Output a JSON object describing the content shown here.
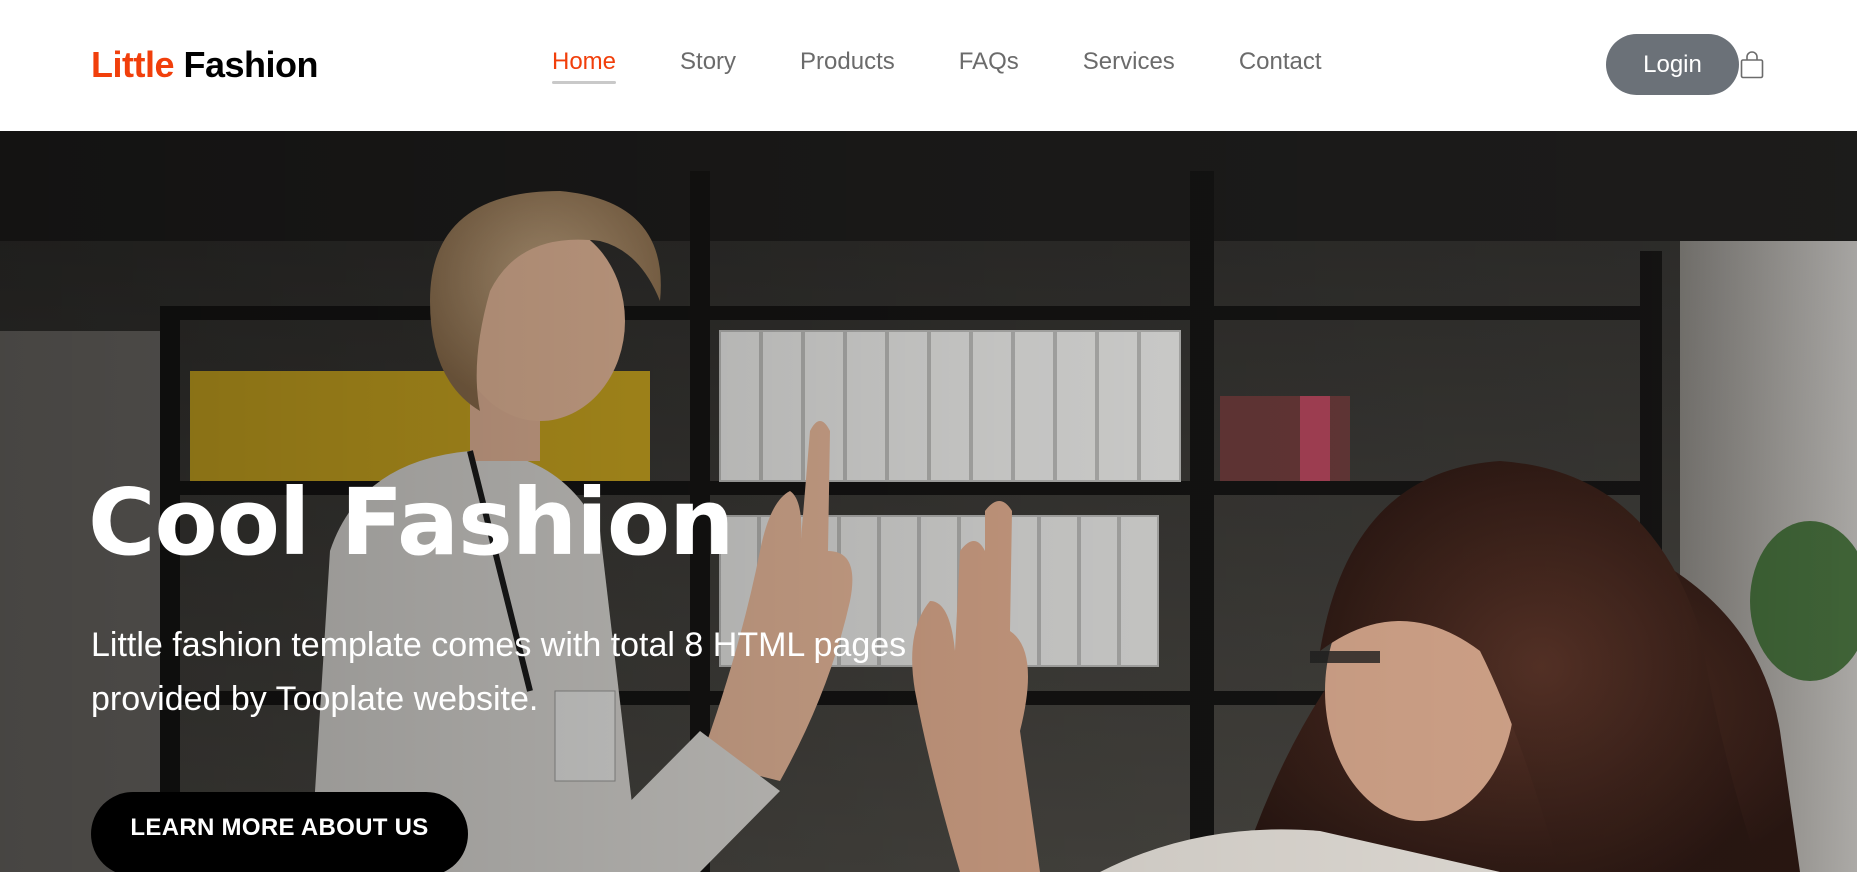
{
  "brand": {
    "part1": "Little",
    "part2": "Fashion"
  },
  "nav": {
    "items": [
      {
        "label": "Home",
        "active": true
      },
      {
        "label": "Story",
        "active": false
      },
      {
        "label": "Products",
        "active": false
      },
      {
        "label": "FAQs",
        "active": false
      },
      {
        "label": "Services",
        "active": false
      },
      {
        "label": "Contact",
        "active": false
      }
    ],
    "login_label": "Login",
    "cart_icon": "shopping-bag-icon"
  },
  "hero": {
    "title": "Cool Fashion",
    "text": "Little fashion template comes with total 8 HTML pages provided by Tooplate website.",
    "button_label": "LEARN MORE ABOUT US",
    "image": "office-high-five-photo"
  },
  "colors": {
    "accent": "#f13f0b",
    "nav_text": "#6b6b6b",
    "login_bg": "#6b7178",
    "cta_bg": "#000000"
  }
}
